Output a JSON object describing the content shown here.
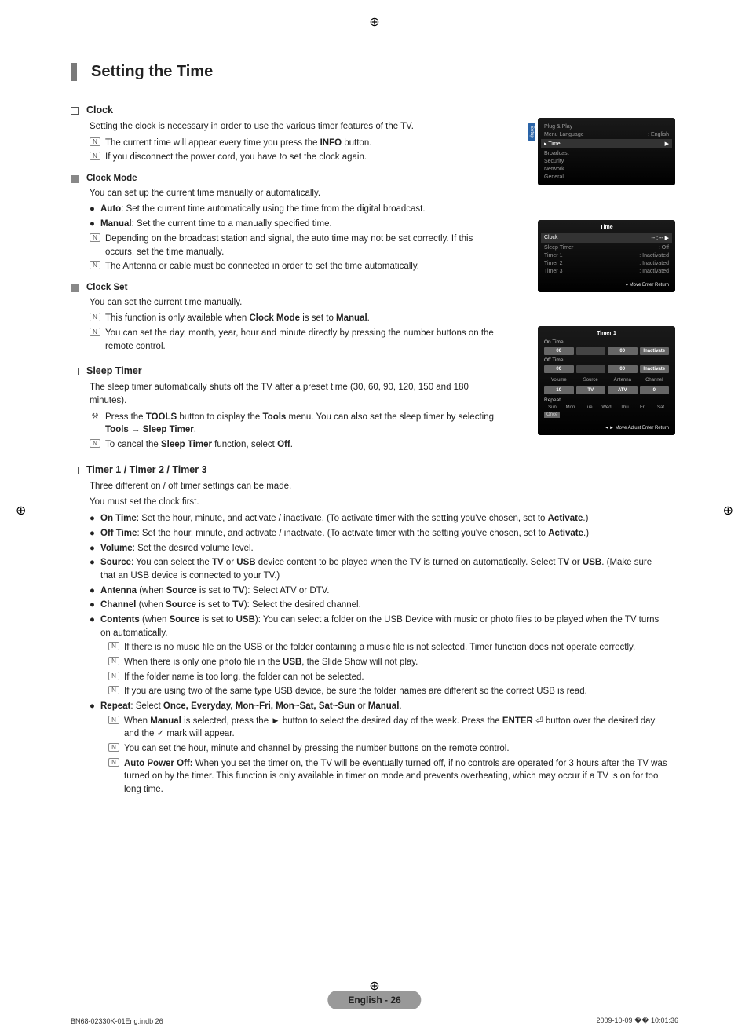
{
  "section_title": "Setting the Time",
  "clock": {
    "heading": "Clock",
    "intro": "Setting the clock is necessary in order to use the various timer features of the TV.",
    "note1_pre": "The current time will appear every time you press the ",
    "note1_bold": "INFO",
    "note1_post": " button.",
    "note2": "If you disconnect the power cord, you have to set the clock again."
  },
  "clock_mode": {
    "heading": "Clock Mode",
    "intro": "You can set up the current time manually or automatically.",
    "auto_label": "Auto",
    "auto_text": ": Set the current time automatically using the time from the digital broadcast.",
    "manual_label": "Manual",
    "manual_text": ": Set the current time to a manually specified time.",
    "note1": "Depending on the broadcast station and signal, the auto time may not be set correctly. If this occurs, set the time manually.",
    "note2": "The Antenna or cable must be connected in order to set the time automatically."
  },
  "clock_set": {
    "heading": "Clock Set",
    "intro": "You can set the current time manually.",
    "note1_pre": "This function is only available when ",
    "note1_b1": "Clock Mode",
    "note1_mid": " is set to ",
    "note1_b2": "Manual",
    "note1_post": ".",
    "note2": "You can set the day, month, year, hour and minute directly by pressing the number buttons on the remote control."
  },
  "sleep": {
    "heading": "Sleep Timer",
    "intro": "The sleep timer automatically shuts off the TV after a preset time (30, 60, 90, 120, 150 and 180 minutes).",
    "tool_pre": "Press the ",
    "tool_b1": "TOOLS",
    "tool_mid": " button to display the ",
    "tool_b2": "Tools",
    "tool_mid2": " menu. You can also set the sleep timer by selecting ",
    "tool_b3": "Tools → Sleep Timer",
    "tool_post": ".",
    "cancel_pre": "To cancel the ",
    "cancel_b1": "Sleep Timer",
    "cancel_mid": " function, select ",
    "cancel_b2": "Off",
    "cancel_post": "."
  },
  "timers": {
    "heading": "Timer 1 / Timer 2 / Timer 3",
    "intro1": "Three different on / off timer settings can be made.",
    "intro2": "You must set the clock first.",
    "on_label": "On Time",
    "on_text_pre": ": Set the hour, minute, and activate / inactivate. (To activate timer with the setting you've chosen, set to ",
    "activate": "Activate",
    "close": ".)",
    "off_label": "Off Time",
    "off_text_pre": ": Set the hour, minute, and activate / inactivate. (To activate timer with the setting you've chosen, set to ",
    "vol_label": "Volume",
    "vol_text": ": Set the desired volume level.",
    "src_label": "Source",
    "src_text_pre": ": You can select the ",
    "src_tv": "TV",
    "src_or": " or ",
    "src_usb": "USB",
    "src_text_mid": " device content to be played when the TV is turned on automatically. Select ",
    "src_text_post": ". (Make sure that an USB device is connected to your TV.)",
    "ant_label": "Antenna",
    "ant_text_pre": " (when ",
    "ant_src": "Source",
    "ant_text_mid": " is set to ",
    "ant_tv": "TV",
    "ant_text_post": "): Select ATV or DTV.",
    "chan_label": "Channel",
    "chan_text_post": "): Select the desired channel.",
    "cont_label": "Contents",
    "cont_usb": "USB",
    "cont_text_post": "): You can select a folder on the USB Device with music or photo files to be played when the TV turns on automatically.",
    "cont_n1": "If there is no music file on the USB or the folder containing a music file is not selected, Timer function does not operate correctly.",
    "cont_n2_pre": "When there is only one photo file in the ",
    "cont_n2_b": "USB",
    "cont_n2_post": ", the Slide Show will not play.",
    "cont_n3": "If the folder name is too long, the folder can not be selected.",
    "cont_n4": "If you are using two of the same type USB device, be sure the folder names are different so the correct USB is read.",
    "rep_label": "Repeat",
    "rep_text_pre": ": Select ",
    "rep_opts": "Once, Everyday, Mon~Fri, Mon~Sat, Sat~Sun",
    "rep_or": " or ",
    "rep_manual": "Manual",
    "rep_post": ".",
    "rep_n1_pre": "When ",
    "rep_n1_b1": "Manual",
    "rep_n1_mid": " is selected, press the ► button to select the desired day of the week. Press the ",
    "rep_n1_b2": "ENTER",
    "rep_n1_mid2": " button over the desired day and the ✓ mark will appear.",
    "rep_n2": "You can set the hour, minute and channel by pressing the number buttons on the remote control.",
    "rep_n3_b": "Auto Power Off:",
    "rep_n3_text": " When you set the timer on, the TV will be eventually turned off, if no controls are operated for 3 hours after the TV was turned on by the timer. This function is only available in timer on mode and prevents overheating, which may occur if a TV is on for too long time."
  },
  "ui1": {
    "setup_tab": "Setup",
    "items": [
      "Plug & Play",
      "Menu Language",
      "Time",
      "Broadcast",
      "Security",
      "Network",
      "General"
    ],
    "lang_val": ": English",
    "time_prefix": "▸ "
  },
  "ui2": {
    "title": "Time",
    "rows": [
      {
        "k": "Clock",
        "v": ": -- : --"
      },
      {
        "k": "Sleep Timer",
        "v": ": Off"
      },
      {
        "k": "Timer 1",
        "v": ": Inactivated"
      },
      {
        "k": "Timer 2",
        "v": ": Inactivated"
      },
      {
        "k": "Timer 3",
        "v": ": Inactivated"
      }
    ],
    "footer": "  Move    Enter    Return"
  },
  "ui3": {
    "title": "Timer 1",
    "on": "On Time",
    "off": "Off Time",
    "labels": [
      "Volume",
      "Source",
      "Antenna",
      "Channel"
    ],
    "vals_top": [
      "00",
      "",
      "00",
      "Inactivate"
    ],
    "vals_off": [
      "00",
      "",
      "00",
      "Inactivate"
    ],
    "vals_bottom": [
      "10",
      "TV",
      "ATV",
      "0"
    ],
    "repeat": "Repeat",
    "repeat_val": "Once",
    "days": [
      "Sun",
      "Mon",
      "Tue",
      "Wed",
      "Thu",
      "Fri",
      "Sat"
    ],
    "footer": "  Move    Adjust    Enter    Return"
  },
  "footer_label": "English - 26",
  "doc_foot_left": "BN68-02330K-01Eng.indb   26",
  "doc_foot_right": "2009-10-09   �� 10:01:36"
}
